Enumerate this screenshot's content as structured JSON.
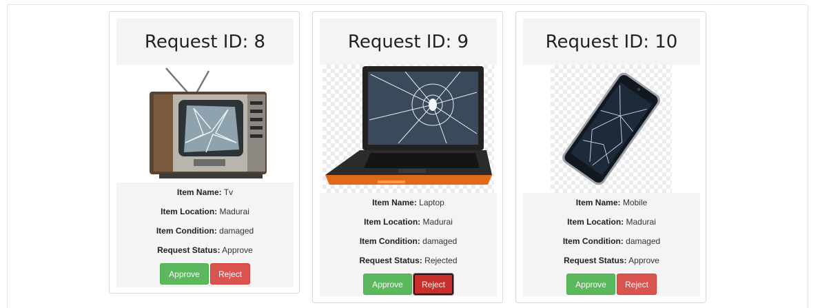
{
  "labels": {
    "item_name": "Item Name:",
    "item_location": "Item Location:",
    "item_condition": "Item Condition:",
    "request_status": "Request Status:",
    "approve": "Approve",
    "reject": "Reject"
  },
  "requests": [
    {
      "title": "Request ID: 8",
      "item_name": "Tv",
      "item_location": "Madurai",
      "item_condition": "damaged",
      "request_status": "Approve",
      "image": "broken-tv"
    },
    {
      "title": "Request ID: 9",
      "item_name": "Laptop",
      "item_location": "Madurai",
      "item_condition": "damaged",
      "request_status": "Rejected",
      "image": "broken-laptop"
    },
    {
      "title": "Request ID: 10",
      "item_name": "Mobile",
      "item_location": "Madurai",
      "item_condition": "damaged",
      "request_status": "Approve",
      "image": "broken-phone"
    }
  ],
  "colors": {
    "approve": "#5cb85c",
    "reject": "#d9534f",
    "panel": "#f4f4f4"
  }
}
